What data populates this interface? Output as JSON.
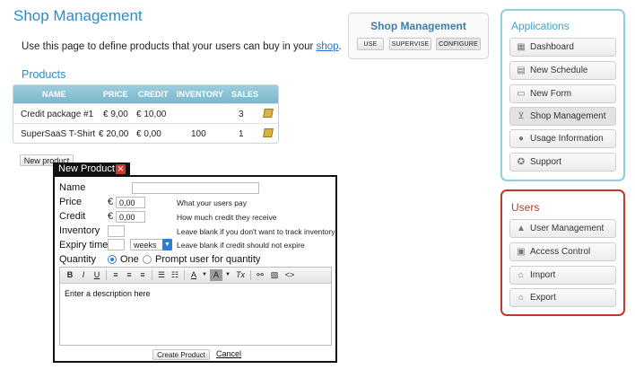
{
  "header": {
    "title": "Shop Management",
    "intro": "Use this page to define products that your users can buy in your",
    "intro_link": "shop",
    "intro_end": "."
  },
  "products": {
    "section_title": "Products",
    "columns": [
      "NAME",
      "PRICE",
      "CREDIT",
      "INVENTORY",
      "SALES"
    ],
    "rows": [
      {
        "name": "Credit package #1",
        "price": "€ 9,00",
        "credit": "€ 10,00",
        "inventory": "",
        "sales": "3"
      },
      {
        "name": "SuperSaaS T-Shirt",
        "price": "€ 20,00",
        "credit": "€ 0,00",
        "inventory": "100",
        "sales": "1"
      }
    ],
    "new_button": "New product"
  },
  "shop_box": {
    "title": "Shop Management",
    "buttons": [
      "USE",
      "SUPERVISE",
      "CONFIGURE"
    ]
  },
  "applications": {
    "title": "Applications",
    "items": [
      {
        "label": "Dashboard",
        "icon": "dashboard-icon"
      },
      {
        "label": "New Schedule",
        "icon": "calendar-icon"
      },
      {
        "label": "New Form",
        "icon": "form-icon"
      },
      {
        "label": "Shop Management",
        "icon": "cart-icon"
      },
      {
        "label": "Usage Information",
        "icon": "info-icon"
      },
      {
        "label": "Support",
        "icon": "support-icon"
      }
    ]
  },
  "users": {
    "title": "Users",
    "items": [
      {
        "label": "User Management",
        "icon": "user-icon"
      },
      {
        "label": "Access Control",
        "icon": "lock-icon"
      },
      {
        "label": "Import",
        "icon": "import-icon"
      },
      {
        "label": "Export",
        "icon": "export-icon"
      }
    ]
  },
  "modal": {
    "title": "New Product",
    "fields": {
      "name_label": "Name",
      "price_label": "Price",
      "price_currency": "€",
      "price_value": "0,00",
      "price_hint": "What your users pay",
      "credit_label": "Credit",
      "credit_currency": "€",
      "credit_value": "0,00",
      "credit_hint": "How much credit they receive",
      "inventory_label": "Inventory",
      "inventory_hint": "Leave blank if you don't want to track inventory",
      "expiry_label": "Expiry time",
      "expiry_unit": "weeks",
      "expiry_hint": "Leave blank if credit should not expire",
      "quantity_label": "Quantity",
      "quantity_one": "One",
      "quantity_prompt": "Prompt user for quantity"
    },
    "editor": {
      "toolbar": {
        "bold": "B",
        "italic": "I",
        "underline": "U",
        "text_color": "A",
        "bg_color": "A",
        "clear": "Tx",
        "source": "<>"
      },
      "placeholder": "Enter a description here"
    },
    "create_button": "Create Product",
    "cancel_link": "Cancel"
  },
  "colors": {
    "accent": "#2a8fc7",
    "apps_border": "#8fcfda",
    "users_border": "#c0392b",
    "table_header": "#8cc3d6"
  }
}
